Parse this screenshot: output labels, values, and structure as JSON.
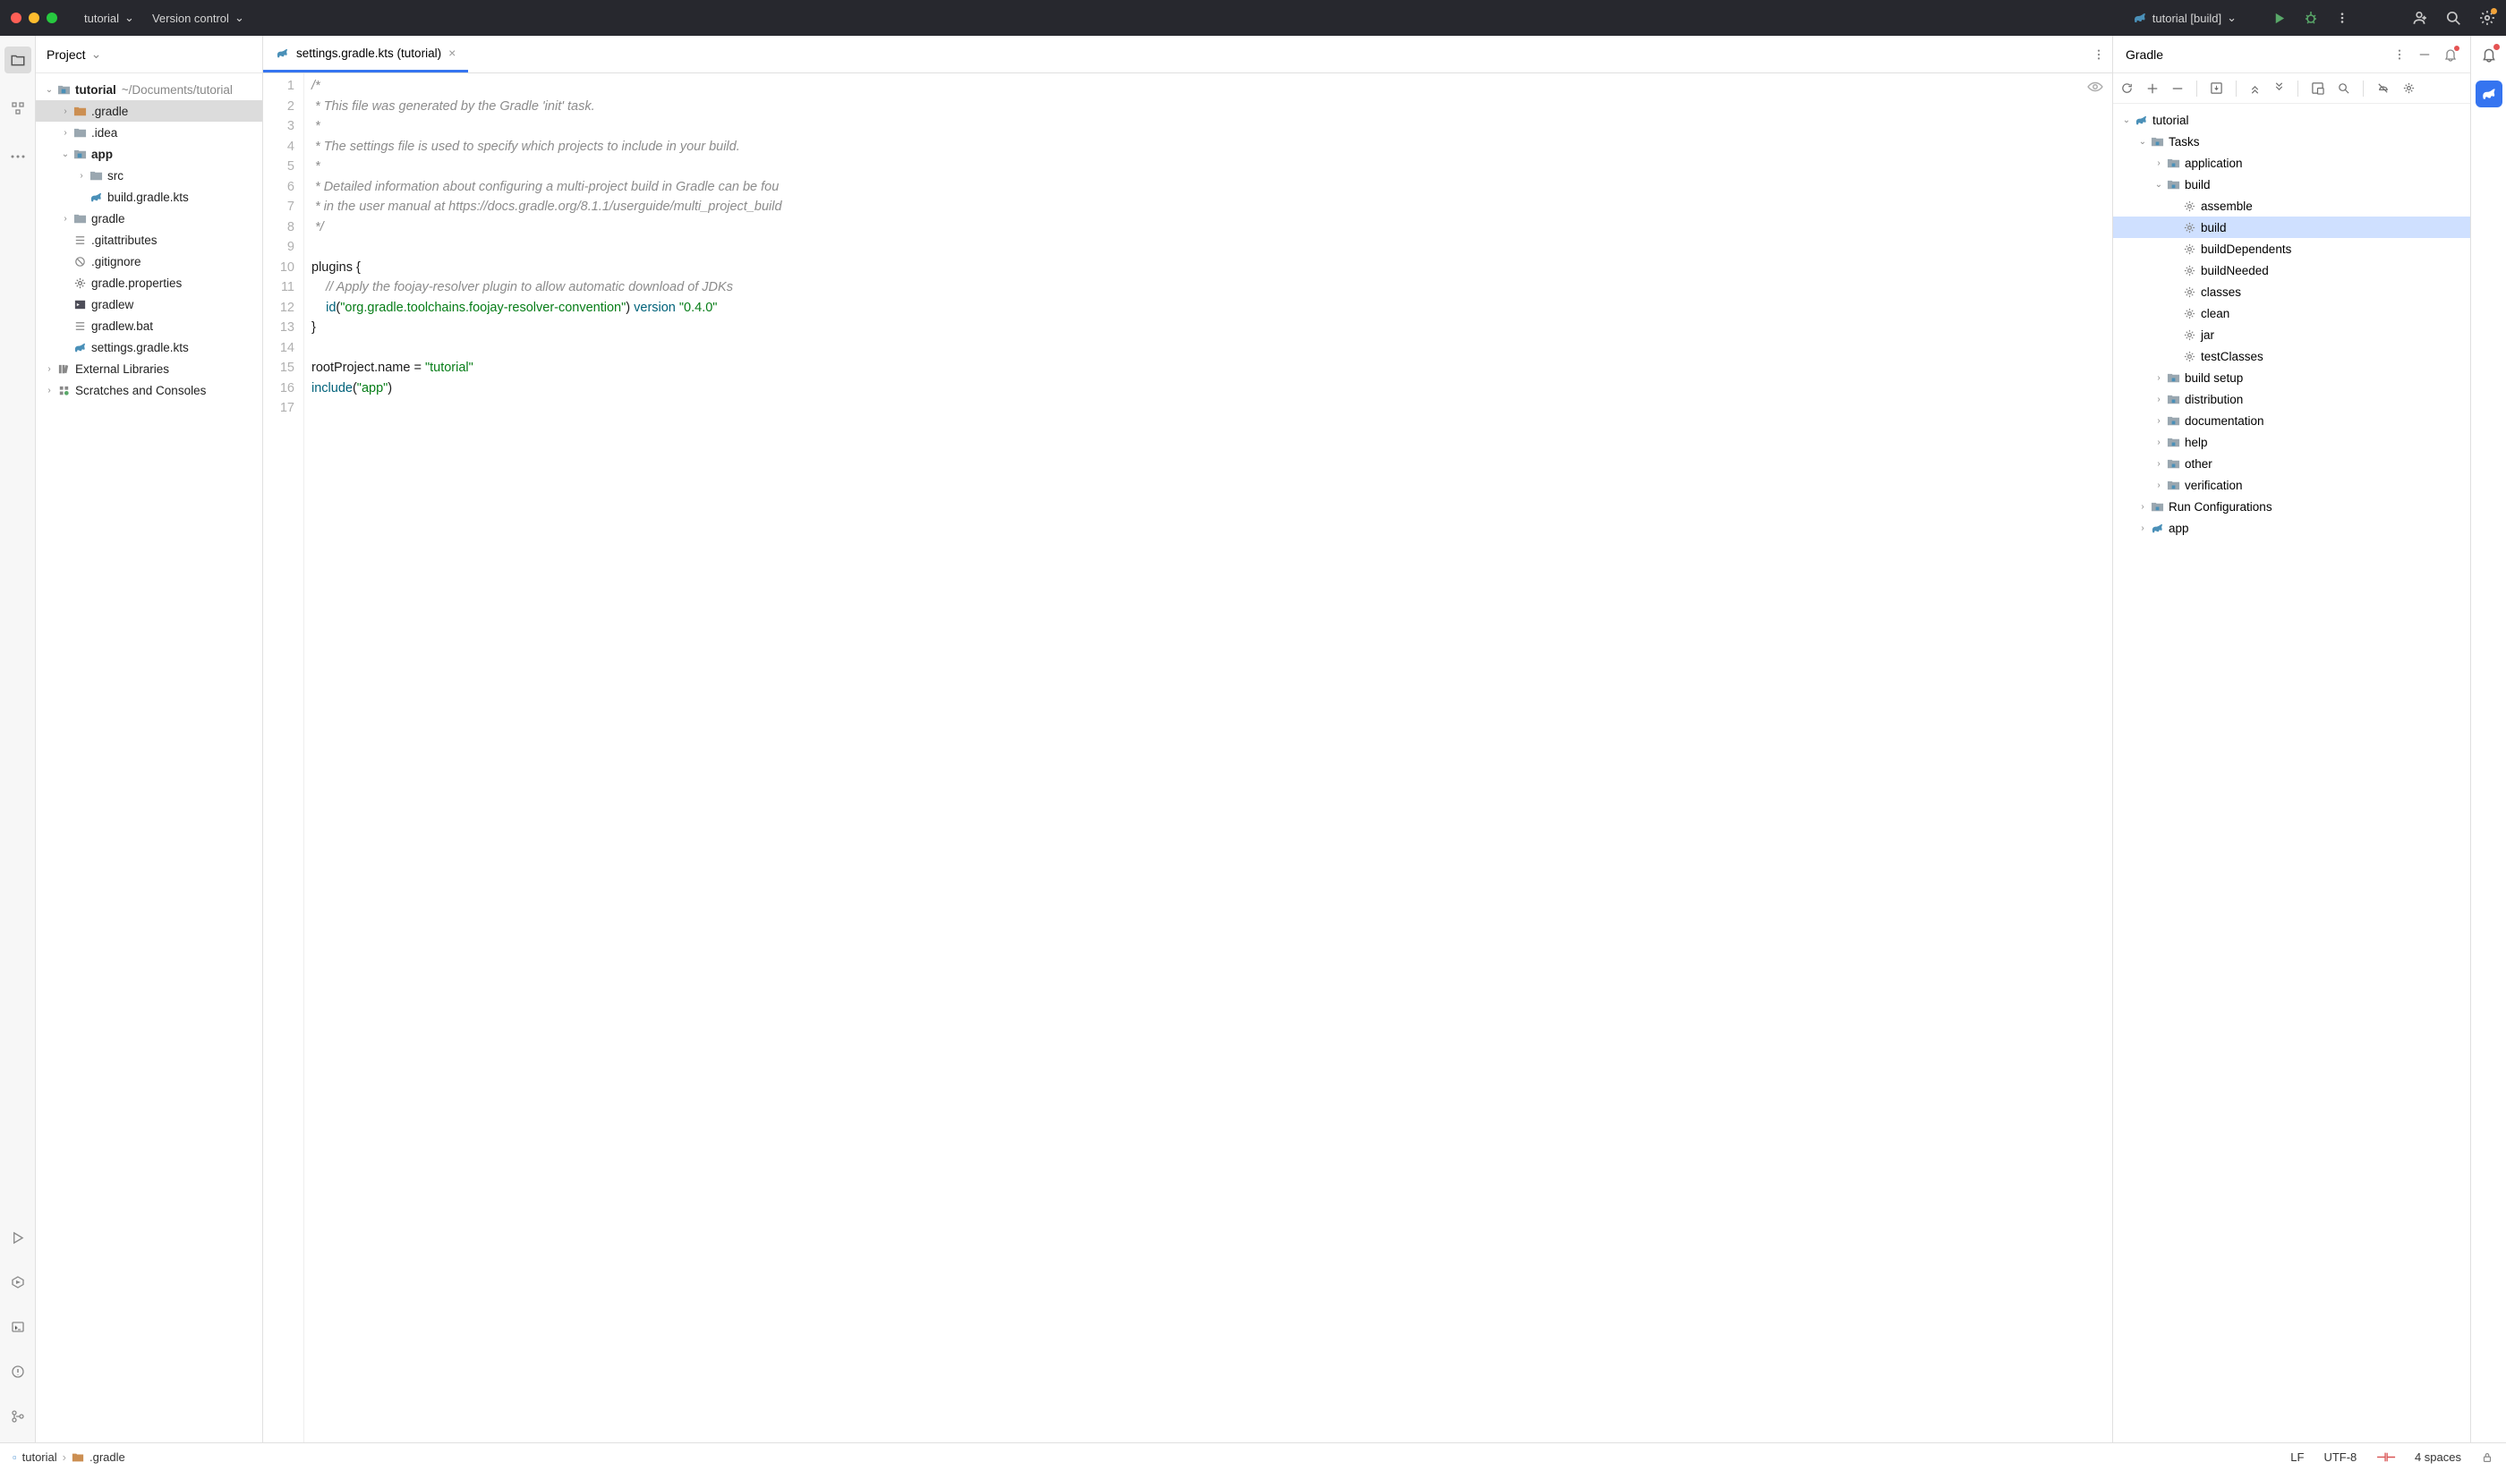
{
  "titlebar": {
    "project_menu": "tutorial",
    "vcs_menu": "Version control",
    "run_config": "tutorial [build]"
  },
  "project_panel": {
    "title": "Project",
    "tree": {
      "root": {
        "label": "tutorial",
        "path": "~/Documents/tutorial"
      },
      "gradle_dir": ".gradle",
      "idea_dir": ".idea",
      "app_dir": "app",
      "src_dir": "src",
      "build_gradle_kts": "build.gradle.kts",
      "gradle_wrapper_dir": "gradle",
      "gitattributes": ".gitattributes",
      "gitignore": ".gitignore",
      "gradle_properties": "gradle.properties",
      "gradlew": "gradlew",
      "gradlew_bat": "gradlew.bat",
      "settings_gradle_kts": "settings.gradle.kts",
      "external_libs": "External Libraries",
      "scratches": "Scratches and Consoles"
    }
  },
  "editor": {
    "tab_label": "settings.gradle.kts (tutorial)",
    "lines": [
      "/*",
      " * This file was generated by the Gradle 'init' task.",
      " *",
      " * The settings file is used to specify which projects to include in your build.",
      " *",
      " * Detailed information about configuring a multi-project build in Gradle can be fou",
      " * in the user manual at https://docs.gradle.org/8.1.1/userguide/multi_project_build",
      " */",
      "",
      "plugins {",
      "    // Apply the foojay-resolver plugin to allow automatic download of JDKs",
      "    id(\"org.gradle.toolchains.foojay-resolver-convention\") version \"0.4.0\"",
      "}",
      "",
      "rootProject.name = \"tutorial\"",
      "include(\"app\")",
      ""
    ]
  },
  "gradle_panel": {
    "title": "Gradle",
    "root": "tutorial",
    "tasks": "Tasks",
    "application": "application",
    "build_group": "build",
    "tasks_build": [
      "assemble",
      "build",
      "buildDependents",
      "buildNeeded",
      "classes",
      "clean",
      "jar",
      "testClasses"
    ],
    "build_setup": "build setup",
    "distribution": "distribution",
    "documentation": "documentation",
    "help": "help",
    "other": "other",
    "verification": "verification",
    "run_configs": "Run Configurations",
    "app": "app"
  },
  "status": {
    "crumb_project": "tutorial",
    "crumb_folder": ".gradle",
    "line_sep": "LF",
    "encoding": "UTF-8",
    "indent": "4 spaces"
  }
}
